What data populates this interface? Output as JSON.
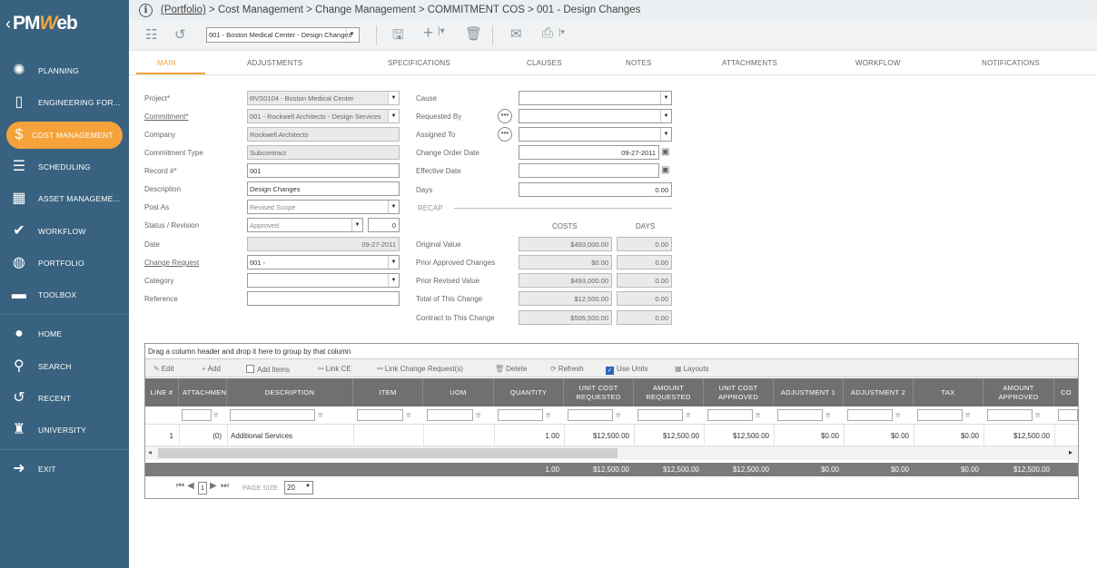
{
  "sidebar": {
    "logo_left": "PM",
    "logo_w": "W",
    "logo_right": "eb",
    "items": [
      {
        "label": "PLANNING",
        "icon": "lightbulb-icon"
      },
      {
        "label": "ENGINEERING FOR...",
        "icon": "document-icon"
      },
      {
        "label": "COST MANAGEMENT",
        "icon": "dollar-icon"
      },
      {
        "label": "SCHEDULING",
        "icon": "gantt-icon"
      },
      {
        "label": "ASSET MANAGEME...",
        "icon": "building-icon"
      },
      {
        "label": "WORKFLOW",
        "icon": "check-icon"
      },
      {
        "label": "PORTFOLIO",
        "icon": "globe-icon"
      },
      {
        "label": "TOOLBOX",
        "icon": "toolbox-icon"
      },
      {
        "label": "HOME",
        "icon": "person-icon"
      },
      {
        "label": "SEARCH",
        "icon": "search-icon"
      },
      {
        "label": "RECENT",
        "icon": "history-icon"
      },
      {
        "label": "UNIVERSITY",
        "icon": "graduation-cap-icon"
      },
      {
        "label": "EXIT",
        "icon": "exit-icon"
      }
    ],
    "active_color": "#f6a23b",
    "bg_color": "#38627f"
  },
  "breadcrumb": {
    "portfolio": "(Portfolio)",
    "rest": " > Cost Management > Change Management > COMMITMENT COS > 001 - Design Changes"
  },
  "toolbar": {
    "record_select": "001 - Boston Medical Center - Design Changes"
  },
  "tabs": [
    "MAIN",
    "ADJUSTMENTS",
    "SPECIFICATIONS",
    "CLAUSES",
    "NOTES",
    "ATTACHMENTS",
    "WORKFLOW",
    "NOTIFICATIONS"
  ],
  "form": {
    "project_label": "Project*",
    "project": "RVS0104 - Boston Medical Center",
    "commitment_label": "Commitment*",
    "commitment": "001 - Rockwell Architects - Design Services",
    "company_label": "Company",
    "company": "Rockwell Architects",
    "commitment_type_label": "Commitment Type",
    "commitment_type": "Subcontract",
    "record_label": "Record #*",
    "record": "001",
    "description_label": "Description",
    "description": "Design Changes",
    "post_as_label": "Post As",
    "post_as": "Revised Scope",
    "status_label": "Status / Revision",
    "status": "Approved",
    "revision": "0",
    "date_label": "Date",
    "date": "09-27-2011",
    "change_request_label": "Change Request",
    "change_request": "001 -",
    "category_label": "Category",
    "category": "",
    "reference_label": "Reference",
    "reference": "",
    "cause_label": "Cause",
    "cause": "",
    "requested_by_label": "Requested By",
    "requested_by": "",
    "assigned_to_label": "Assigned To",
    "assigned_to": "",
    "change_order_date_label": "Change Order Date",
    "change_order_date": "09-27-2011",
    "effective_date_label": "Effective Date",
    "effective_date": "",
    "days_label": "Days",
    "days": "0.00",
    "recap_label": "RECAP",
    "costs_label": "COSTS",
    "days_col_label": "DAYS",
    "recap": [
      {
        "label": "Original Value",
        "cost": "$493,000.00",
        "days": "0.00"
      },
      {
        "label": "Prior Approved Changes",
        "cost": "$0.00",
        "days": "0.00"
      },
      {
        "label": "Prior Revised Value",
        "cost": "$493,000.00",
        "days": "0.00"
      },
      {
        "label": "Total of This Change",
        "cost": "$12,500.00",
        "days": "0.00"
      },
      {
        "label": "Contract to This Change",
        "cost": "$505,500.00",
        "days": "0.00"
      }
    ]
  },
  "grid": {
    "group_hint": "Drag a column header and drop it here to group by that column",
    "toolbar": [
      "Edit",
      "Add",
      "Add Items",
      "Link CE",
      "Link Change Request(s)",
      "Delete",
      "Refresh",
      "Use Units",
      "Layouts"
    ],
    "use_units_checked": true,
    "headers": [
      "LINE #",
      "ATTACHMENTS",
      "DESCRIPTION",
      "ITEM",
      "UOM",
      "QUANTITY",
      "UNIT COST REQUESTED",
      "AMOUNT REQUESTED",
      "UNIT COST APPROVED",
      "ADJUSTMENT 1",
      "ADJUSTMENT 2",
      "TAX",
      "AMOUNT APPROVED",
      "CO"
    ],
    "row": {
      "line": "1",
      "attachments": "(0)",
      "description": "Additional Services",
      "item": "",
      "uom": "",
      "quantity": "1.00",
      "unit_cost_requested": "$12,500.00",
      "amount_requested": "$12,500.00",
      "unit_cost_approved": "$12,500.00",
      "adjustment1": "$0.00",
      "adjustment2": "$0.00",
      "tax": "$0.00",
      "amount_approved": "$12,500.00"
    },
    "totals": {
      "quantity": "1.00",
      "unit_cost_requested": "$12,500.00",
      "amount_requested": "$12,500.00",
      "unit_cost_approved": "$12,500.00",
      "adjustment1": "$0.00",
      "adjustment2": "$0.00",
      "tax": "$0.00",
      "amount_approved": "$12,500.00"
    },
    "pager": {
      "page": "1",
      "page_size_label": "PAGE SIZE",
      "page_size": "20"
    }
  }
}
